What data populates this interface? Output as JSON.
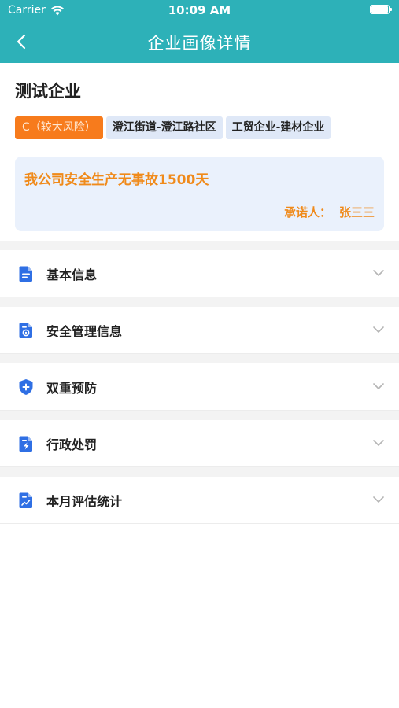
{
  "status_bar": {
    "carrier": "Carrier",
    "time": "10:09 AM"
  },
  "nav": {
    "title": "企业画像详情"
  },
  "company": {
    "name": "测试企业",
    "tags": [
      {
        "label": "C（较大风险）",
        "type": "risk"
      },
      {
        "label": "澄江街道-澄江路社区",
        "type": "area"
      },
      {
        "label": "工贸企业-建材企业",
        "type": "industry"
      }
    ]
  },
  "pledge": {
    "text": "我公司安全生产无事故1500天",
    "person_label": "承诺人：",
    "person_name": "张三三"
  },
  "sections": [
    {
      "label": "基本信息",
      "icon": "document-icon"
    },
    {
      "label": "安全管理信息",
      "icon": "settings-document-icon"
    },
    {
      "label": "双重预防",
      "icon": "shield-plus-icon"
    },
    {
      "label": "行政处罚",
      "icon": "lightning-document-icon"
    },
    {
      "label": "本月评估统计",
      "icon": "chart-document-icon"
    }
  ],
  "colors": {
    "header": "#2db1b8",
    "risk_tag": "#f77b1c",
    "pledge_text": "#f08a1a",
    "icon_blue": "#2f6fe4"
  }
}
